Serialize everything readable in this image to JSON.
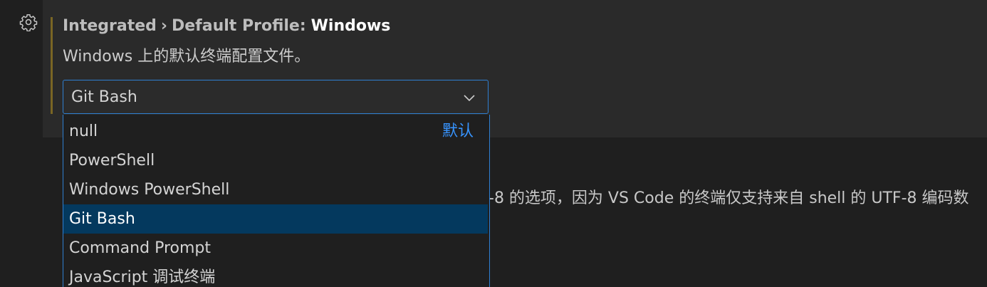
{
  "setting": {
    "category": "Integrated",
    "separator": "›",
    "label_prefix": "Default Profile:",
    "label_name": "Windows",
    "description": "Windows 上的默认终端配置文件。"
  },
  "select": {
    "current_value": "Git Bash"
  },
  "dropdown": {
    "options": [
      {
        "label": "null",
        "tag": "默认"
      },
      {
        "label": "PowerShell"
      },
      {
        "label": "Windows PowerShell"
      },
      {
        "label": "Git Bash"
      },
      {
        "label": "Command Prompt"
      },
      {
        "label": "JavaScript 调试终端"
      }
    ],
    "selected_index": 3
  },
  "background_setting": {
    "description_fragment": "-8 的选项，因为 VS Code 的终端仅支持来自 shell 的 UTF-8 编码数"
  },
  "colors": {
    "focus_border": "#2f7fd1",
    "selected_bg": "#04395e",
    "modified_indicator": "#7a6624",
    "default_tag": "#3794ff"
  },
  "icons": {
    "gear": "gear-icon",
    "chevron": "chevron-down-icon"
  }
}
